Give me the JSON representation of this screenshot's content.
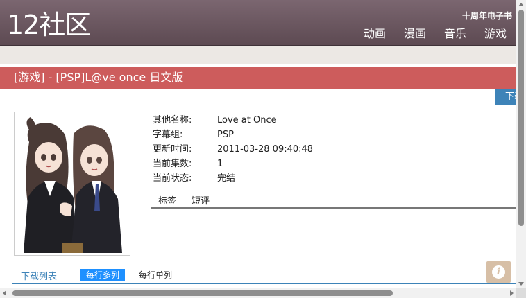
{
  "header": {
    "logo": "12社区",
    "promo": "十周年电子书",
    "nav": [
      "动画",
      "漫画",
      "音乐",
      "游戏"
    ]
  },
  "title": "[游戏] - [PSP]L@ve once 日文版",
  "download_tab": "下载",
  "info": [
    {
      "key": "其他名称:",
      "value": "Love at Once"
    },
    {
      "key": "字幕组:",
      "value": "PSP"
    },
    {
      "key": "更新时间:",
      "value": "2011-03-28 09:40:48"
    },
    {
      "key": "当前集数:",
      "value": "1"
    },
    {
      "key": "当前状态:",
      "value": "完结"
    }
  ],
  "subtabs": [
    "标签",
    "短评"
  ],
  "download_list": {
    "label": "下载列表",
    "mode_multi": "每行多列",
    "mode_single": "每行单列"
  },
  "info_button_glyph": "i",
  "colors": {
    "header_top": "#7b6670",
    "header_bottom": "#5d4a52",
    "title_bar": "#cd5c5c",
    "accent_blue": "#3d83b8",
    "mode_active": "#1e90ff",
    "info_button": "#d7bfa6"
  }
}
